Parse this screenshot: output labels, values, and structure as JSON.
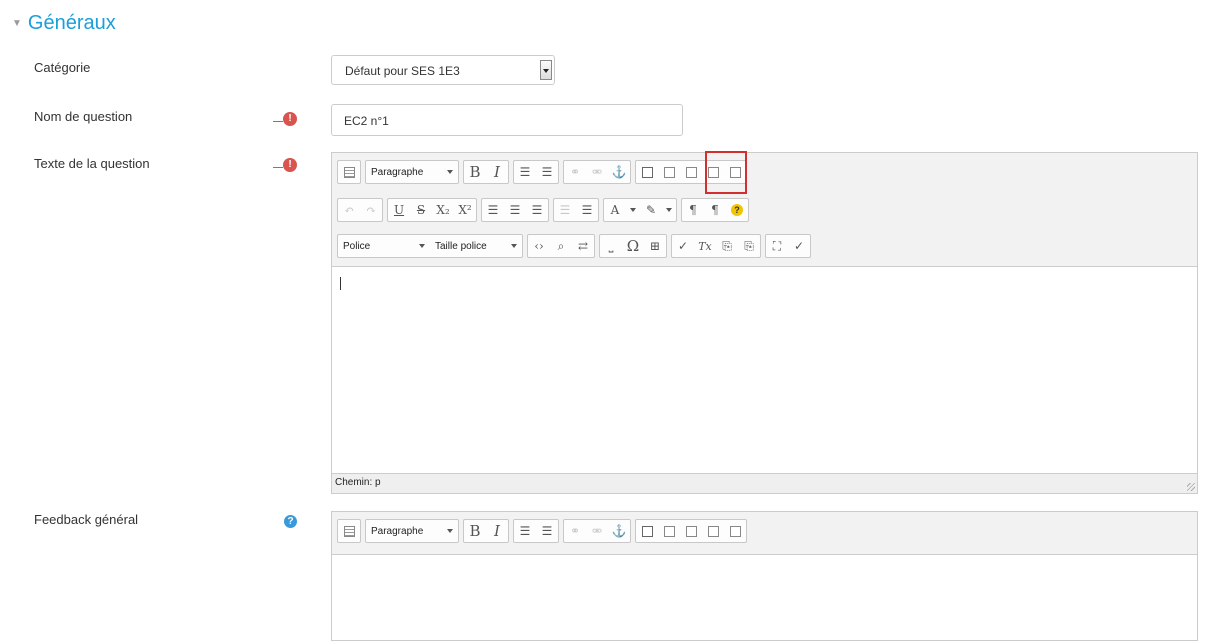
{
  "section": {
    "title": "Généraux"
  },
  "fields": {
    "category": {
      "label": "Catégorie",
      "value": "Défaut pour SES 1E3"
    },
    "name": {
      "label": "Nom de question",
      "value": "EC2 n°1",
      "required_icon": "!"
    },
    "question_text": {
      "label": "Texte de la question",
      "required_icon": "!",
      "status": "Chemin: p"
    },
    "feedback": {
      "label": "Feedback général",
      "help_icon": "?"
    }
  },
  "toolbar": {
    "format_label": "Paragraphe",
    "font_label": "Police",
    "size_label": "Taille police",
    "bold": "B",
    "italic": "I",
    "underline": "U",
    "strike": "S",
    "sub": "X₂",
    "sup": "X²",
    "omega": "Ω",
    "clear_format": "Tx",
    "help": "?"
  },
  "colors": {
    "accent": "#1a9fd8",
    "required": "#d9534f",
    "help": "#3a9ad9",
    "highlight": "#d32f2f"
  }
}
